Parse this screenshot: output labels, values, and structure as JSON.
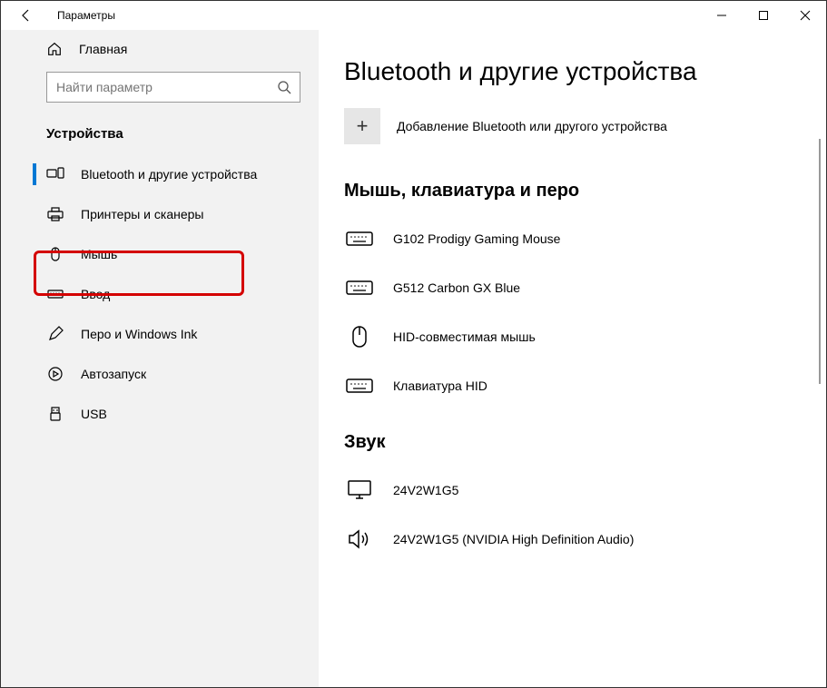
{
  "window": {
    "title": "Параметры"
  },
  "sidebar": {
    "home_label": "Главная",
    "search_placeholder": "Найти параметр",
    "category": "Устройства",
    "items": [
      {
        "label": "Bluetooth и другие устройства"
      },
      {
        "label": "Принтеры и сканеры"
      },
      {
        "label": "Мышь"
      },
      {
        "label": "Ввод"
      },
      {
        "label": "Перо и Windows Ink"
      },
      {
        "label": "Автозапуск"
      },
      {
        "label": "USB"
      }
    ]
  },
  "content": {
    "heading": "Bluetooth и другие устройства",
    "add_label": "Добавление Bluetooth или другого устройства",
    "sections": [
      {
        "title": "Мышь, клавиатура и перо",
        "devices": [
          {
            "label": "G102 Prodigy Gaming Mouse",
            "icon": "keyboard"
          },
          {
            "label": "G512 Carbon GX Blue",
            "icon": "keyboard"
          },
          {
            "label": "HID-совместимая мышь",
            "icon": "mouse"
          },
          {
            "label": "Клавиатура HID",
            "icon": "keyboard"
          }
        ]
      },
      {
        "title": "Звук",
        "devices": [
          {
            "label": "24V2W1G5",
            "icon": "monitor"
          },
          {
            "label": "24V2W1G5 (NVIDIA High Definition Audio)",
            "icon": "speaker"
          }
        ]
      }
    ]
  }
}
